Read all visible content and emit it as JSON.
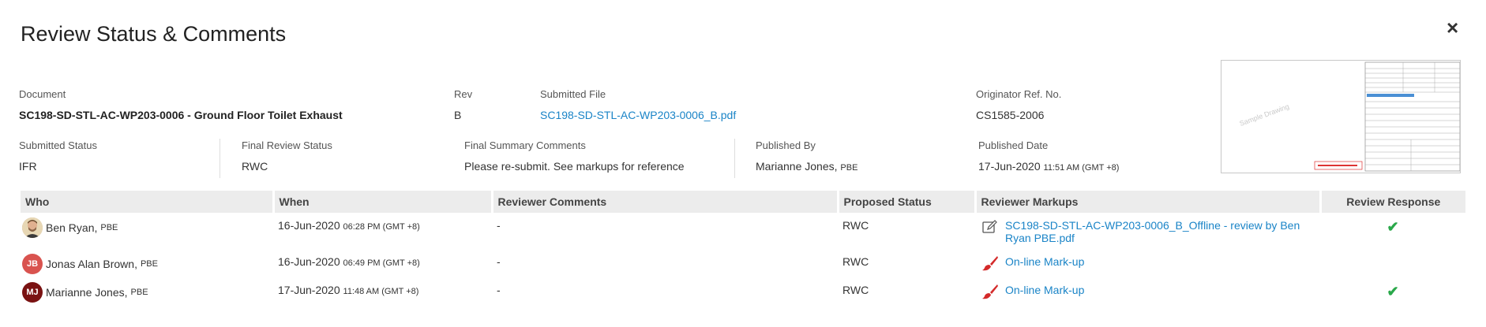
{
  "modal": {
    "title": "Review Status & Comments",
    "close_label": "×"
  },
  "info": {
    "document_label": "Document",
    "document_value": "SC198-SD-STL-AC-WP203-0006 - Ground Floor Toilet Exhaust",
    "rev_label": "Rev",
    "rev_value": "B",
    "submitted_file_label": "Submitted File",
    "submitted_file_value": "SC198-SD-STL-AC-WP203-0006_B.pdf",
    "originator_label": "Originator Ref. No.",
    "originator_value": "CS1585-2006",
    "submitted_status_label": "Submitted Status",
    "submitted_status_value": "IFR",
    "final_review_label": "Final Review Status",
    "final_review_value": "RWC",
    "final_summary_label": "Final Summary Comments",
    "final_summary_value": "Please re-submit. See markups for reference",
    "published_by_label": "Published By",
    "published_by_name": "Marianne Jones,",
    "published_by_org": "PBE",
    "published_date_label": "Published Date",
    "published_date": "17-Jun-2020",
    "published_time": "11:51 AM (GMT +8)"
  },
  "table": {
    "headers": [
      "Who",
      "When",
      "Reviewer Comments",
      "Proposed Status",
      "Reviewer Markups",
      "Review Response"
    ],
    "rows": [
      {
        "name": "Ben Ryan,",
        "org": "PBE",
        "avatar": "photo",
        "date": "16-Jun-2020",
        "time": "06:28 PM (GMT +8)",
        "comments": "-",
        "status": "RWC",
        "markup_icon": "edit-icon",
        "markup_text": "SC198-SD-STL-AC-WP203-0006_B_Offline - review by Ben Ryan PBE.pdf",
        "response": "✔"
      },
      {
        "name": "Jonas Alan Brown,",
        "org": "PBE",
        "avatar": "JB",
        "date": "16-Jun-2020",
        "time": "06:49 PM (GMT +8)",
        "comments": "-",
        "status": "RWC",
        "markup_icon": "brush-icon",
        "markup_text": "On-line Mark-up",
        "response": ""
      },
      {
        "name": "Marianne Jones,",
        "org": "PBE",
        "avatar": "MJ",
        "date": "17-Jun-2020",
        "time": "11:48 AM (GMT +8)",
        "comments": "-",
        "status": "RWC",
        "markup_icon": "brush-icon",
        "markup_text": "On-line Mark-up",
        "response": "✔"
      }
    ]
  },
  "colors": {
    "link": "#1a84c7",
    "check": "#2aa84a",
    "avatar_jb": "#d9534f",
    "avatar_mj": "#7a1212",
    "brush": "#d42a2a"
  }
}
